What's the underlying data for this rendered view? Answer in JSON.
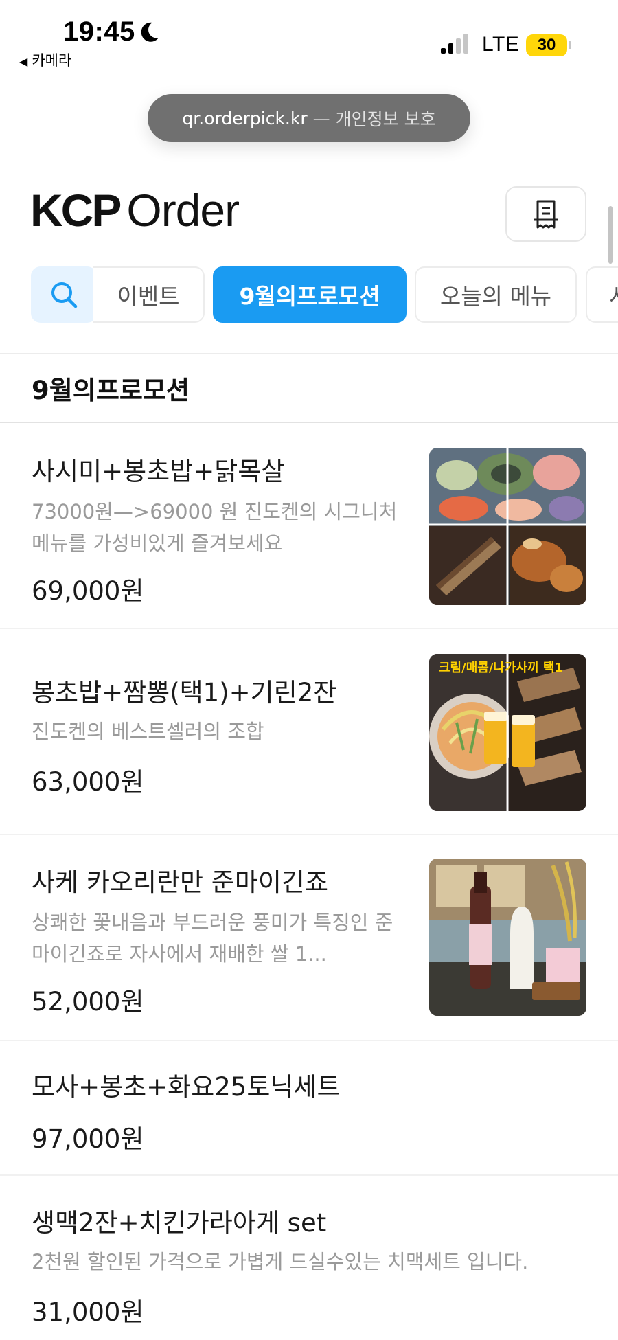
{
  "status_bar": {
    "time": "19:45",
    "back_label": "카메라",
    "network": "LTE",
    "battery": "30"
  },
  "browser": {
    "url": "qr.orderpick.kr",
    "separator": "—",
    "privacy_label": "개인정보 보호"
  },
  "header": {
    "brand_bold": "KCP",
    "brand_rest": "Order"
  },
  "tabs": [
    {
      "label": "이벤트",
      "active": false
    },
    {
      "label": "9월의프로모션",
      "active": true
    },
    {
      "label": "오늘의 메뉴",
      "active": false
    },
    {
      "label": "시",
      "active": false
    }
  ],
  "section": {
    "title": "9월의프로모션"
  },
  "menu": [
    {
      "name": "사시미+봉초밥+닭목살",
      "description": "73000원—>69000 원 진도켄의 시그니처 메뉴를 가성비있게 즐겨보세요",
      "price": "69,000원"
    },
    {
      "name": "봉초밥+짬뽕(택1)+기린2잔",
      "description": "진도켄의 베스트셀러의 조합",
      "price": "63,000원",
      "image_caption": "크림/매콤/나가사끼 택1"
    },
    {
      "name": "사케 카오리란만 준마이긴죠",
      "description": "상쾌한 꽃내음과 부드러운 풍미가 특징인 준마이긴죠로 자사에서 재배한 쌀 1...",
      "price": "52,000원"
    },
    {
      "name": "모사+봉초+화요25토닉세트",
      "price": "97,000원"
    },
    {
      "name": "생맥2잔+치킨가라아게 set",
      "description": "2천원 할인된 가격으로 가볍게 드실수있는 치맥세트 입니다.",
      "price": "31,000원"
    }
  ],
  "colors": {
    "accent": "#1a9bf2",
    "search_bg": "#e6f3ff",
    "battery": "#ffd60a",
    "url_pill": "#707070"
  }
}
